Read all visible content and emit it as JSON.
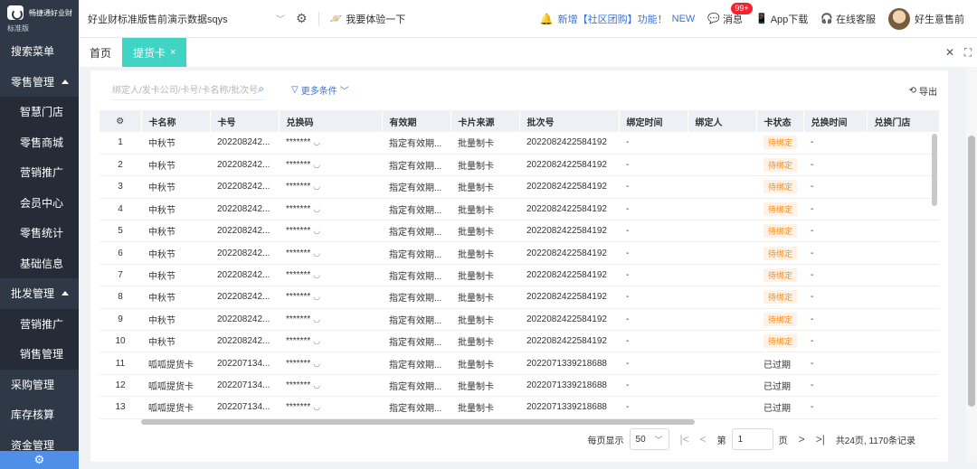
{
  "sidebar": {
    "logo_name": "畅捷通好业财",
    "edition": "标准版",
    "items": [
      {
        "label": "搜索菜单",
        "type": "top",
        "caret": false
      },
      {
        "label": "零售管理",
        "type": "top",
        "caret": true
      },
      {
        "label": "智慧门店",
        "type": "sub"
      },
      {
        "label": "零售商城",
        "type": "sub"
      },
      {
        "label": "营销推广",
        "type": "sub"
      },
      {
        "label": "会员中心",
        "type": "sub"
      },
      {
        "label": "零售统计",
        "type": "sub"
      },
      {
        "label": "基础信息",
        "type": "sub"
      },
      {
        "label": "批发管理",
        "type": "top",
        "caret": true
      },
      {
        "label": "营销推广",
        "type": "sub"
      },
      {
        "label": "销售管理",
        "type": "sub"
      },
      {
        "label": "采购管理",
        "type": "top",
        "caret": false
      },
      {
        "label": "库存核算",
        "type": "top",
        "caret": false
      },
      {
        "label": "资金管理",
        "type": "top",
        "caret": false
      }
    ]
  },
  "header": {
    "store_name": "好业财标准版售前演示数据sqys",
    "try_label": "我要体验一下",
    "notice": "新增【社区团购】功能！",
    "notice_new": "NEW",
    "message_label": "消息",
    "message_badge": "99+",
    "app_label": "App下载",
    "service_label": "在线客服",
    "user_name": "好生意售前"
  },
  "tabs": [
    {
      "label": "首页",
      "active": false
    },
    {
      "label": "提货卡",
      "active": true
    }
  ],
  "filter": {
    "search_placeholder": "绑定人/发卡公司/卡号/卡名称/批次号",
    "more_label": "更多条件",
    "export_label": "导出"
  },
  "table": {
    "columns": [
      "",
      "卡名称",
      "卡号",
      "兑换码",
      "有效期",
      "卡片来源",
      "批次号",
      "绑定时间",
      "绑定人",
      "卡状态",
      "兑换时间",
      "兑换门店"
    ],
    "rows": [
      {
        "idx": "1",
        "name": "中秋节",
        "card_no": "202208242...",
        "code": "*******",
        "validity": "指定有效期...",
        "source": "批量制卡",
        "batch": "2022082422584192",
        "bind_time": "-",
        "binder": "",
        "status": "待绑定",
        "status_type": "pending",
        "redeem_time": "-",
        "store": ""
      },
      {
        "idx": "2",
        "name": "中秋节",
        "card_no": "202208242...",
        "code": "*******",
        "validity": "指定有效期...",
        "source": "批量制卡",
        "batch": "2022082422584192",
        "bind_time": "-",
        "binder": "",
        "status": "待绑定",
        "status_type": "pending",
        "redeem_time": "-",
        "store": ""
      },
      {
        "idx": "3",
        "name": "中秋节",
        "card_no": "202208242...",
        "code": "*******",
        "validity": "指定有效期...",
        "source": "批量制卡",
        "batch": "2022082422584192",
        "bind_time": "-",
        "binder": "",
        "status": "待绑定",
        "status_type": "pending",
        "redeem_time": "-",
        "store": ""
      },
      {
        "idx": "4",
        "name": "中秋节",
        "card_no": "202208242...",
        "code": "*******",
        "validity": "指定有效期...",
        "source": "批量制卡",
        "batch": "2022082422584192",
        "bind_time": "-",
        "binder": "",
        "status": "待绑定",
        "status_type": "pending",
        "redeem_time": "-",
        "store": ""
      },
      {
        "idx": "5",
        "name": "中秋节",
        "card_no": "202208242...",
        "code": "*******",
        "validity": "指定有效期...",
        "source": "批量制卡",
        "batch": "2022082422584192",
        "bind_time": "-",
        "binder": "",
        "status": "待绑定",
        "status_type": "pending",
        "redeem_time": "-",
        "store": ""
      },
      {
        "idx": "6",
        "name": "中秋节",
        "card_no": "202208242...",
        "code": "*******",
        "validity": "指定有效期...",
        "source": "批量制卡",
        "batch": "2022082422584192",
        "bind_time": "-",
        "binder": "",
        "status": "待绑定",
        "status_type": "pending",
        "redeem_time": "-",
        "store": ""
      },
      {
        "idx": "7",
        "name": "中秋节",
        "card_no": "202208242...",
        "code": "*******",
        "validity": "指定有效期...",
        "source": "批量制卡",
        "batch": "2022082422584192",
        "bind_time": "-",
        "binder": "",
        "status": "待绑定",
        "status_type": "pending",
        "redeem_time": "-",
        "store": ""
      },
      {
        "idx": "8",
        "name": "中秋节",
        "card_no": "202208242...",
        "code": "*******",
        "validity": "指定有效期...",
        "source": "批量制卡",
        "batch": "2022082422584192",
        "bind_time": "-",
        "binder": "",
        "status": "待绑定",
        "status_type": "pending",
        "redeem_time": "-",
        "store": ""
      },
      {
        "idx": "9",
        "name": "中秋节",
        "card_no": "202208242...",
        "code": "*******",
        "validity": "指定有效期...",
        "source": "批量制卡",
        "batch": "2022082422584192",
        "bind_time": "-",
        "binder": "",
        "status": "待绑定",
        "status_type": "pending",
        "redeem_time": "-",
        "store": ""
      },
      {
        "idx": "10",
        "name": "中秋节",
        "card_no": "202208242...",
        "code": "*******",
        "validity": "指定有效期...",
        "source": "批量制卡",
        "batch": "2022082422584192",
        "bind_time": "-",
        "binder": "",
        "status": "待绑定",
        "status_type": "pending",
        "redeem_time": "-",
        "store": ""
      },
      {
        "idx": "11",
        "name": "呱呱提货卡",
        "card_no": "202207134...",
        "code": "*******",
        "validity": "指定有效期...",
        "source": "批量制卡",
        "batch": "2022071339218688",
        "bind_time": "-",
        "binder": "",
        "status": "已过期",
        "status_type": "expired",
        "redeem_time": "-",
        "store": ""
      },
      {
        "idx": "12",
        "name": "呱呱提货卡",
        "card_no": "202207134...",
        "code": "*******",
        "validity": "指定有效期...",
        "source": "批量制卡",
        "batch": "2022071339218688",
        "bind_time": "-",
        "binder": "",
        "status": "已过期",
        "status_type": "expired",
        "redeem_time": "-",
        "store": ""
      },
      {
        "idx": "13",
        "name": "呱呱提货卡",
        "card_no": "202207134...",
        "code": "*******",
        "validity": "指定有效期...",
        "source": "批量制卡",
        "batch": "2022071339218688",
        "bind_time": "-",
        "binder": "",
        "status": "已过期",
        "status_type": "expired",
        "redeem_time": "-",
        "store": ""
      }
    ]
  },
  "pager": {
    "per_page_label": "每页显示",
    "page_size": "50",
    "page_prefix": "第",
    "current_page": "1",
    "page_suffix": "页",
    "total": "共24页, 1170条记录"
  },
  "colors": {
    "sidebar_bg": "#2f3846",
    "submenu_bg": "#252c37",
    "active_tab": "#3fd4c3",
    "link": "#3a72d8",
    "pending": "#fa8c16"
  }
}
